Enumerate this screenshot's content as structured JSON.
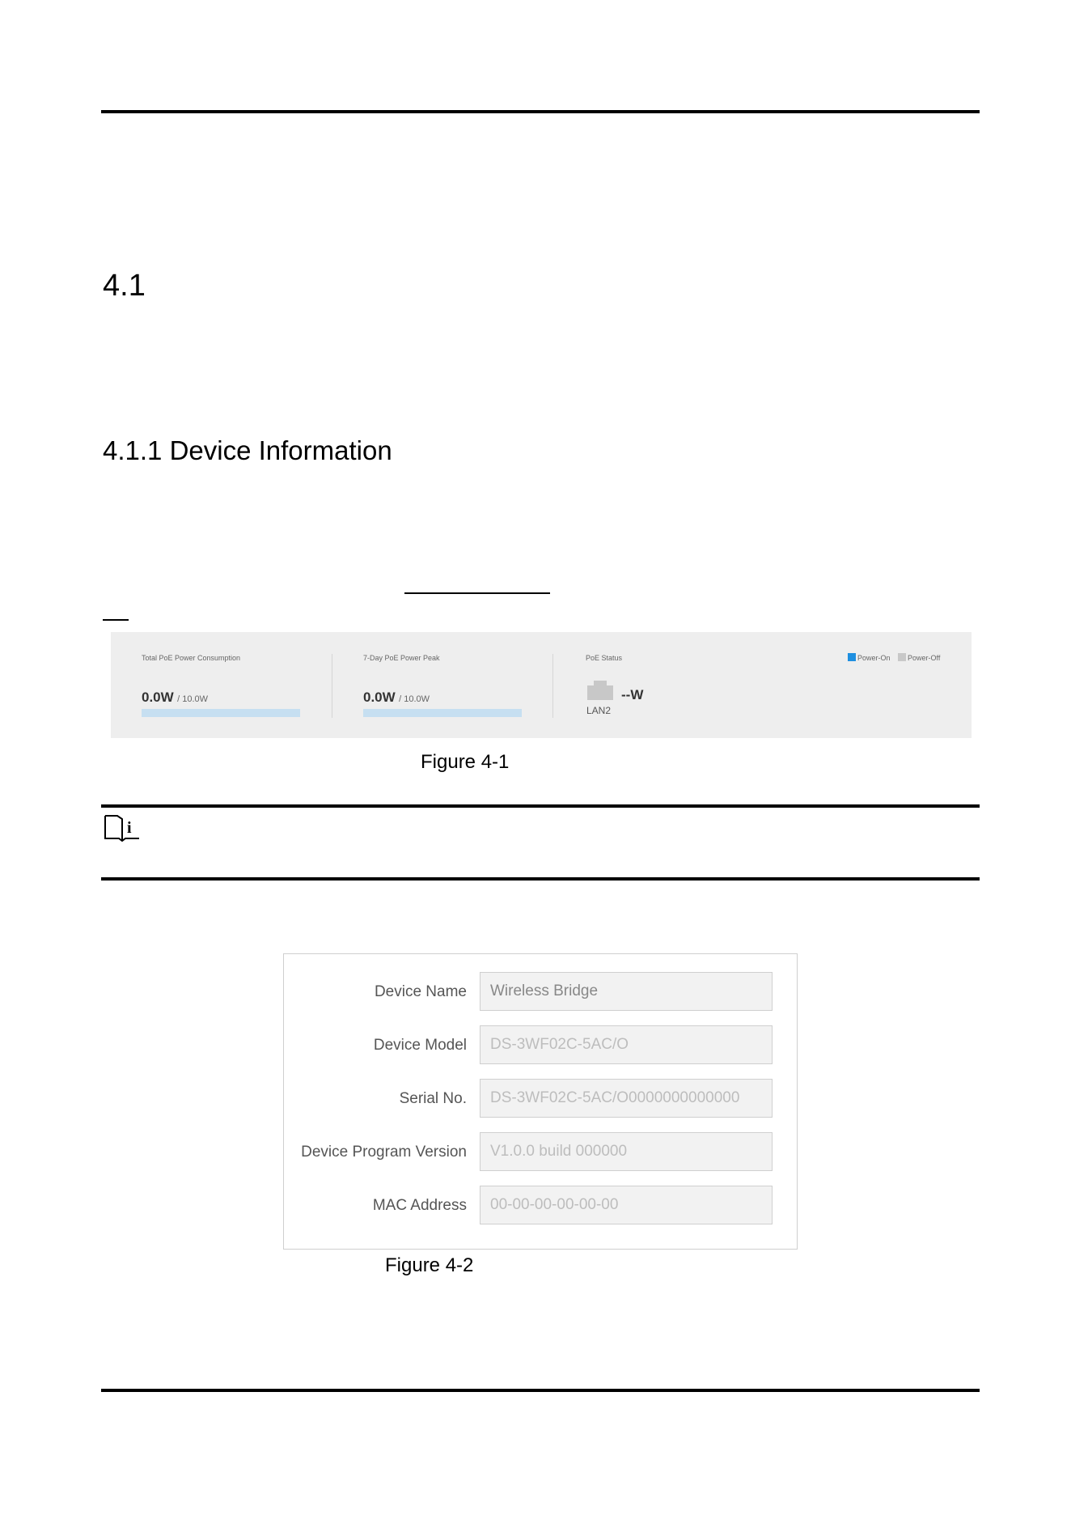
{
  "section": {
    "number": "4.1",
    "subsection_title": "4.1.1 Device Information"
  },
  "figure_1": {
    "caption": "Figure 4-1",
    "total_poe_label": "Total PoE Power Consumption",
    "total_poe_value": "0.0W",
    "total_poe_max": "/ 10.0W",
    "peak_label": "7-Day PoE Power Peak",
    "peak_value": "0.0W",
    "peak_max": "/ 10.0W",
    "status_label": "PoE Status",
    "port_name": "LAN2",
    "port_power": "--W",
    "legend_on": "Power-On",
    "legend_off": "Power-Off",
    "colors": {
      "power_on": "#1e8fe0",
      "power_off": "#c8c8c8",
      "bar": "#c6dff1",
      "panel": "#eeeeee"
    }
  },
  "note": {
    "icon": "note-info-icon"
  },
  "figure_2": {
    "caption": "Figure 4-2",
    "fields": [
      {
        "label": "Device Name",
        "value": "Wireless Bridge"
      },
      {
        "label": "Device Model",
        "value": "DS-3WF02C-5AC/O"
      },
      {
        "label": "Serial No.",
        "value": "DS-3WF02C-5AC/O0000000000000"
      },
      {
        "label": "Device Program Version",
        "value": "V1.0.0 build 000000"
      },
      {
        "label": "MAC Address",
        "value": "00-00-00-00-00-00"
      }
    ]
  }
}
